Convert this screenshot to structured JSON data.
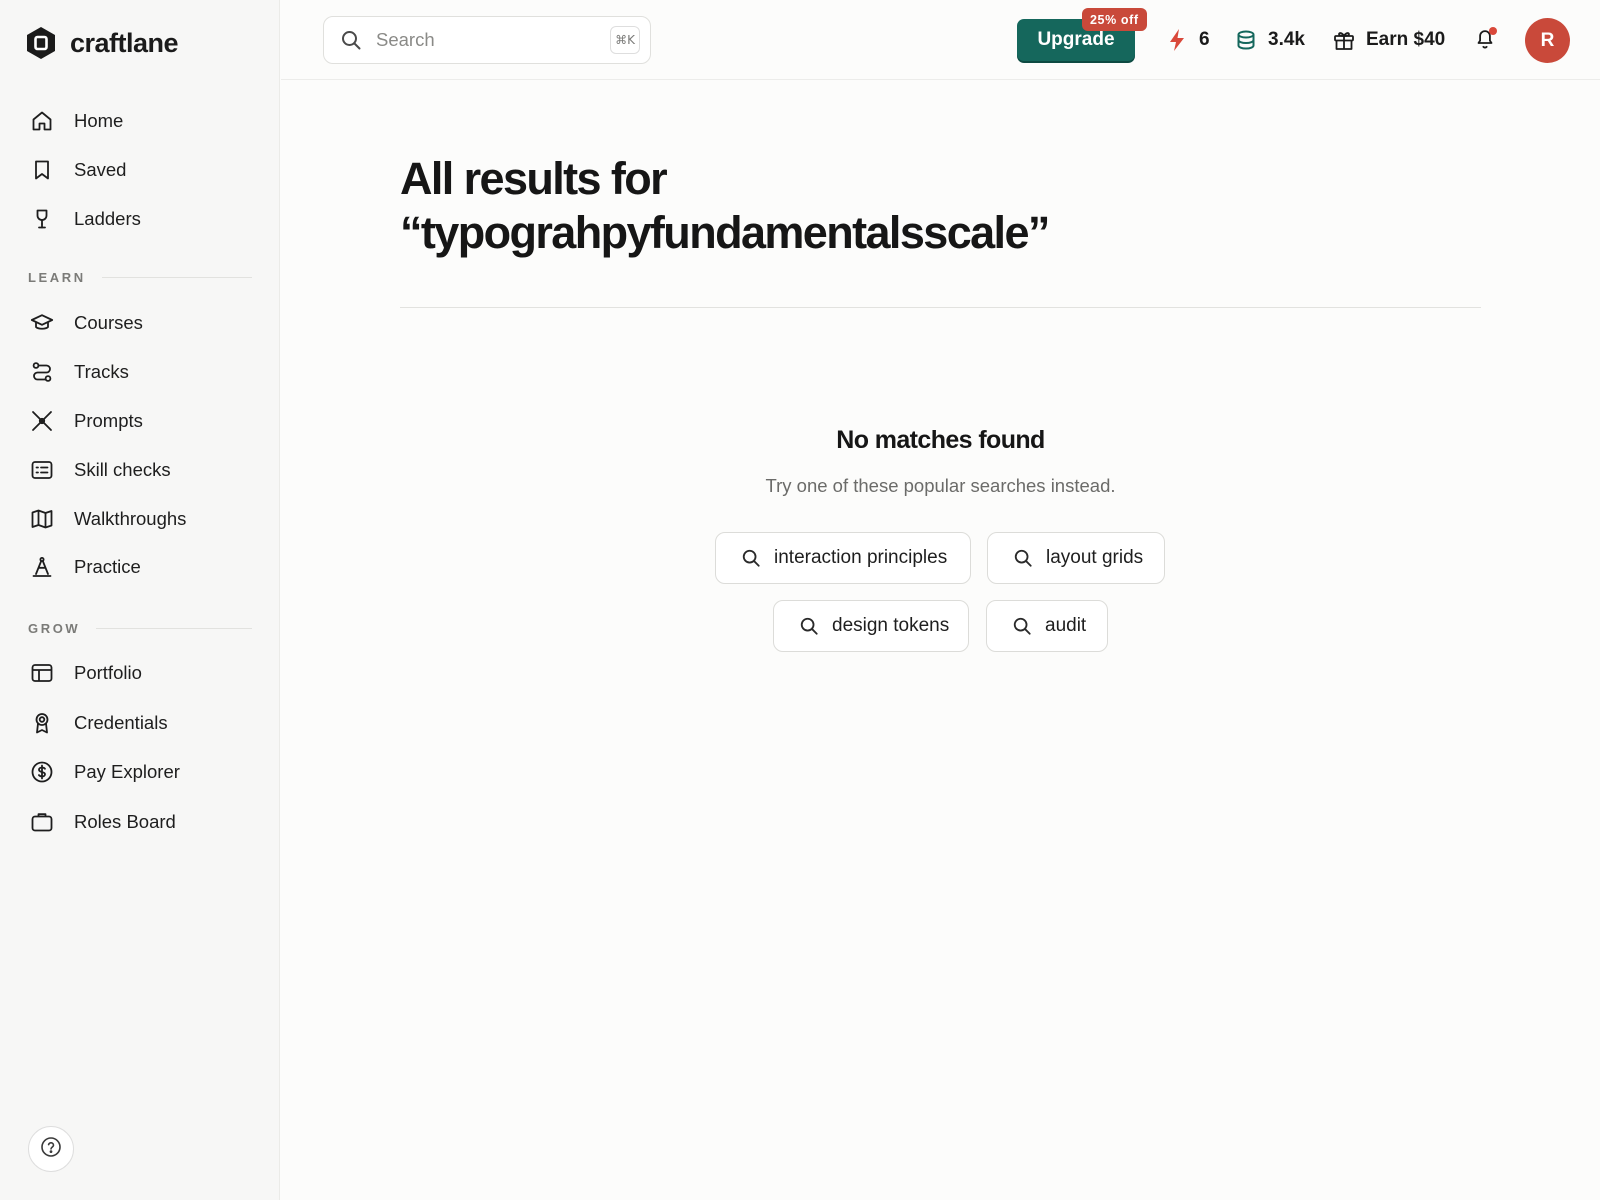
{
  "brand": {
    "name": "craftlane"
  },
  "nav": {
    "primary": [
      {
        "label": "Home",
        "icon": "home-icon"
      },
      {
        "label": "Saved",
        "icon": "bookmark-icon"
      },
      {
        "label": "Ladders",
        "icon": "trophy-icon"
      }
    ],
    "learn_title": "LEARN",
    "learn": [
      {
        "label": "Courses",
        "icon": "graduation-cap-icon"
      },
      {
        "label": "Tracks",
        "icon": "route-icon"
      },
      {
        "label": "Prompts",
        "icon": "crossed-tools-icon"
      },
      {
        "label": "Skill checks",
        "icon": "checklist-icon"
      },
      {
        "label": "Walkthroughs",
        "icon": "map-icon"
      },
      {
        "label": "Practice",
        "icon": "compass-drafting-icon"
      }
    ],
    "grow_title": "GROW",
    "grow": [
      {
        "label": "Portfolio",
        "icon": "layout-icon"
      },
      {
        "label": "Credentials",
        "icon": "award-ribbon-icon"
      },
      {
        "label": "Pay Explorer",
        "icon": "dollar-coin-icon"
      },
      {
        "label": "Roles Board",
        "icon": "briefcase-icon"
      }
    ]
  },
  "header": {
    "search_placeholder": "Search",
    "search_shortcut": "⌘K",
    "upgrade_label": "Upgrade",
    "discount_badge": "25% off",
    "streak_count": "6",
    "coins": "3.4k",
    "referral_label": "Earn $40",
    "avatar_initial": "R"
  },
  "results": {
    "heading_prefix": "All results for",
    "query_display": "“typograhpyfundamentalsscale”",
    "empty_title": "No matches found",
    "empty_subtitle": "Try one of these popular searches instead.",
    "suggestions": [
      "interaction principles",
      "layout grids",
      "design tokens",
      "audit"
    ]
  },
  "colors": {
    "accent": "#15675c",
    "badge": "#c9493a",
    "streak": "#d9483a",
    "coins": "#15675c",
    "avatar": "#c9493a"
  }
}
